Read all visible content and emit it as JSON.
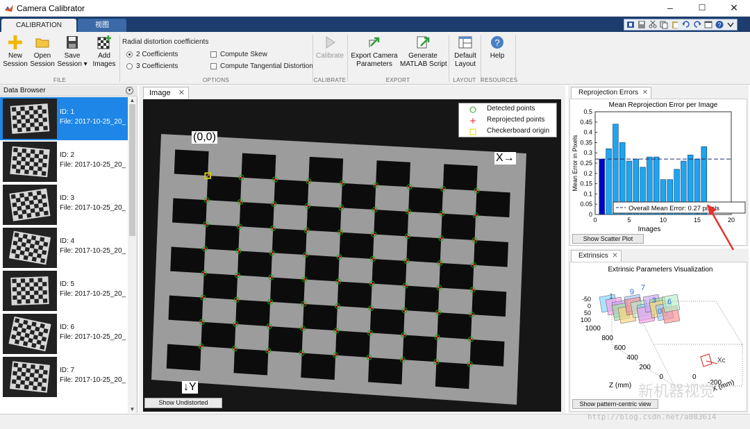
{
  "window": {
    "title": "Camera Calibrator",
    "minimize": "–",
    "maximize": "☐",
    "close": "✕"
  },
  "ribbon_tabs": [
    {
      "label": "CALIBRATION",
      "active": true
    },
    {
      "label": "视图",
      "active": false
    }
  ],
  "toolstrip": {
    "file": {
      "label": "FILE",
      "new_session": "New\nSession",
      "open_session": "Open\nSession",
      "save_session": "Save\nSession ▾",
      "add_images": "Add\nImages"
    },
    "options": {
      "label": "OPTIONS",
      "heading": "Radial distortion coefficients",
      "two_coeff": "2 Coefficients",
      "three_coeff": "3 Coefficients",
      "compute_skew": "Compute Skew",
      "compute_tangential": "Compute Tangential Distortion"
    },
    "calibrate": {
      "label": "CALIBRATE",
      "button": "Calibrate"
    },
    "export": {
      "label": "EXPORT",
      "export_params": "Export Camera\nParameters",
      "generate_script": "Generate\nMATLAB Script"
    },
    "layout": {
      "label": "LAYOUT",
      "default_layout": "Default\nLayout"
    },
    "resources": {
      "label": "RESOURCES",
      "help": "Help"
    }
  },
  "data_browser": {
    "title": "Data Browser",
    "items": [
      {
        "id": "ID: 1",
        "file": "File: 2017-10-25_20_",
        "selected": true
      },
      {
        "id": "ID: 2",
        "file": "File: 2017-10-25_20_",
        "selected": false
      },
      {
        "id": "ID: 3",
        "file": "File: 2017-10-25_20_",
        "selected": false
      },
      {
        "id": "ID: 4",
        "file": "File: 2017-10-25_20_",
        "selected": false
      },
      {
        "id": "ID: 5",
        "file": "File: 2017-10-25_20_",
        "selected": false
      },
      {
        "id": "ID: 6",
        "file": "File: 2017-10-25_20_",
        "selected": false
      },
      {
        "id": "ID: 7",
        "file": "File: 2017-10-25_20_",
        "selected": false
      }
    ]
  },
  "image_panel": {
    "tab": "Image",
    "legend": {
      "detected": "Detected points",
      "reprojected": "Reprojected points",
      "origin": "Checkerboard origin"
    },
    "origin_label": "(0,0)",
    "x_label": "X→",
    "y_label": "↓Y",
    "show_undistorted": "Show Undistorted"
  },
  "reprojection": {
    "tab": "Reprojection Errors",
    "show_scatter": "Show Scatter Plot",
    "chart_data": {
      "type": "bar",
      "title": "Mean Reprojection Error per Image",
      "xlabel": "Images",
      "ylabel": "Mean Error in Pixels",
      "x": [
        1,
        2,
        3,
        4,
        5,
        6,
        7,
        8,
        9,
        10,
        11,
        12,
        13,
        14,
        15,
        16
      ],
      "values": [
        0.27,
        0.32,
        0.44,
        0.35,
        0.26,
        0.27,
        0.23,
        0.28,
        0.28,
        0.17,
        0.17,
        0.22,
        0.26,
        0.29,
        0.27,
        0.33
      ],
      "highlighted_index": 0,
      "mean_line": 0.27,
      "mean_label": "Overall Mean Error: 0.27 pixels",
      "xlim": [
        0,
        20
      ],
      "ylim": [
        0,
        0.5
      ],
      "xticks": [
        0,
        5,
        10,
        15,
        20
      ],
      "yticks": [
        0,
        0.05,
        0.1,
        0.15,
        0.2,
        0.25,
        0.3,
        0.35,
        0.4,
        0.45,
        0.5
      ],
      "bar_color": "#1fa5f0",
      "highlight_color": "#0000c8"
    }
  },
  "extrinsics": {
    "tab": "Extrinsics",
    "title": "Extrinsic Parameters Visualization",
    "z_axis_label": "Z (mm)",
    "x_axis_label": "X (mm)",
    "z_ticks": [
      "1000",
      "800",
      "600",
      "400",
      "200",
      "0"
    ],
    "y_ticks": [
      "-50",
      "0",
      "50",
      "100"
    ],
    "x_ticks": [
      "0",
      "-200"
    ],
    "board_numbers": [
      "1",
      "9",
      "7",
      "3",
      "0",
      "6"
    ],
    "camera_label": "Xc",
    "show_pattern_centric": "Show pattern-centric view"
  },
  "watermarks": {
    "chinese": "新机器视觉",
    "url": "http://blog.csdn.net/a083614"
  }
}
